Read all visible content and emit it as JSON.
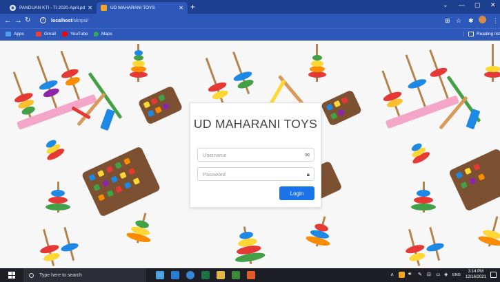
{
  "browser": {
    "tabs": [
      {
        "label": "PANDUAN KTI - TI 2020-April.pdf",
        "active": false
      },
      {
        "label": "UD MAHARANI TOYS",
        "active": true
      }
    ],
    "url_host": "localhost",
    "url_path": "/sknpsi/",
    "bookmarks": [
      {
        "label": "Apps",
        "icon": "apps-grid-icon",
        "color": "#4d9cf0"
      },
      {
        "label": "Gmail",
        "icon": "gmail-icon",
        "color": "#ea4335"
      },
      {
        "label": "YouTube",
        "icon": "youtube-icon",
        "color": "#ff0000"
      },
      {
        "label": "Maps",
        "icon": "maps-pin-icon",
        "color": "#34a853"
      }
    ],
    "reading_list": "Reading list"
  },
  "login": {
    "title": "UD MAHARANI TOYS",
    "username_placeholder": "Username",
    "password_placeholder": "Password",
    "login_label": "Login",
    "accent": "#1a73e8"
  },
  "taskbar": {
    "search_placeholder": "Type here to search",
    "language": "ENG",
    "time": "3:14 PM",
    "date": "12/16/2021"
  }
}
